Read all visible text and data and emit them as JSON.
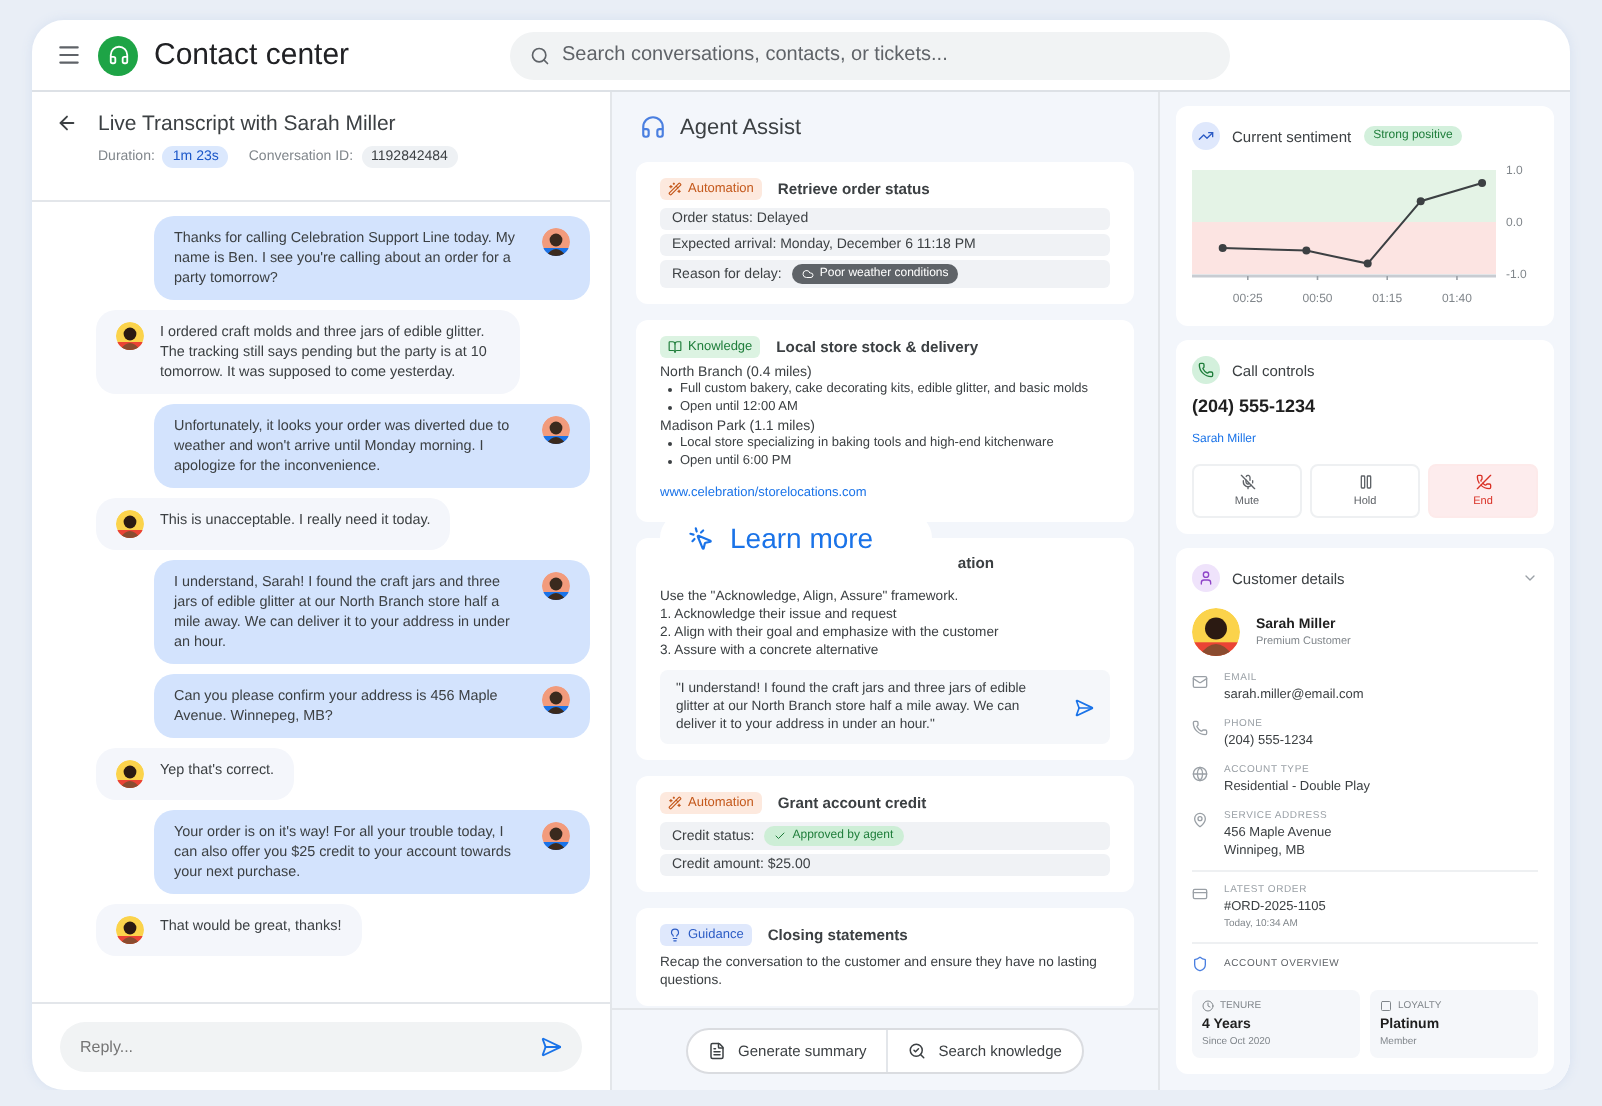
{
  "header": {
    "title": "Contact center",
    "search_placeholder": "Search conversations, contacts, or tickets..."
  },
  "transcript": {
    "title": "Live Transcript with Sarah Miller",
    "duration_label": "Duration:",
    "duration": "1m 23s",
    "conversation_label": "Conversation ID:",
    "conversation_id": "1192842484",
    "messages": [
      {
        "kind": "agent",
        "text": "Thanks for calling Celebration Support Line today. My name is Ben. I see you're calling about an order for a party tomorrow?"
      },
      {
        "kind": "customer",
        "text": "I ordered craft molds and three jars of edible glitter. The tracking still says pending but the party is at 10 tomorrow. It was supposed to come yesterday."
      },
      {
        "kind": "agent",
        "text": "Unfortunately, it looks your order was diverted due to weather and won't arrive until Monday morning. I apologize for the inconvenience."
      },
      {
        "kind": "customer",
        "text": "This is unacceptable. I really need it today."
      },
      {
        "kind": "agent",
        "text": "I understand, Sarah! I found the craft jars and three jars of edible glitter at our North Branch store half a mile away. We can deliver it to your address in under an hour."
      },
      {
        "kind": "agent",
        "text": "Can you please confirm your address is 456 Maple Avenue. Winnepeg, MB?"
      },
      {
        "kind": "customer",
        "text": "Yep that's correct."
      },
      {
        "kind": "agent",
        "text": "Your order is on it's way! For all your trouble today, I can also offer you $25 credit to your account towards your next purchase."
      },
      {
        "kind": "customer",
        "text": "That would be great, thanks!"
      }
    ],
    "reply_placeholder": "Reply..."
  },
  "assist": {
    "title": "Agent Assist",
    "cards": [
      {
        "kind": "automation",
        "badge": "Automation",
        "title": "Retrieve order status",
        "rows": [
          {
            "text": "Order status: Delayed"
          },
          {
            "text": "Expected arrival: Monday, December 6 11:18 PM"
          },
          {
            "text": "Reason for delay:",
            "chip": {
              "kind": "weather",
              "text": "Poor weather conditions"
            }
          }
        ]
      },
      {
        "kind": "knowledge",
        "badge": "Knowledge",
        "title": "Local store stock & delivery",
        "sections": [
          {
            "name": "North Branch (0.4 miles)",
            "bullets": [
              "Full custom bakery, cake decorating kits, edible glitter, and basic molds",
              "Open until 12:00 AM"
            ]
          },
          {
            "name": "Madison Park (1.1 miles)",
            "bullets": [
              "Local store specializing in baking tools and high-end kitchenware",
              "Open until 6:00 PM"
            ]
          }
        ],
        "link": "www.celebration/storelocations.com"
      },
      {
        "kind": "guidance_hidden",
        "title": "ation",
        "lines": [
          "Use the \"Acknowledge, Align, Assure\" framework.",
          "1. Acknowledge their issue and request",
          "2. Align with their goal and emphasize with the customer",
          "3. Assure with a concrete alternative"
        ],
        "suggestion": "\"I understand! I found the craft jars and three jars of edible glitter at our North Branch store half a mile away. We can deliver it to your address in under an hour.\""
      },
      {
        "kind": "automation",
        "badge": "Automation",
        "title": "Grant account credit",
        "rows": [
          {
            "text": "Credit status:",
            "chip": {
              "kind": "approved",
              "text": "Approved by agent"
            }
          },
          {
            "text": "Credit amount: $25.00"
          }
        ]
      },
      {
        "kind": "guidance",
        "badge": "Guidance",
        "title": "Closing statements",
        "lines": [
          "Recap the conversation to the customer and ensure they have no lasting questions."
        ]
      }
    ],
    "learn_more": "Learn more",
    "actions": [
      {
        "kind": "summary",
        "label": "Generate summary"
      },
      {
        "kind": "search",
        "label": "Search knowledge"
      }
    ]
  },
  "sentiment": {
    "title": "Current sentiment",
    "badge": "Strong positive",
    "chart_data": {
      "type": "line",
      "x": [
        16,
        46,
        68,
        87,
        109
      ],
      "series": [
        {
          "color": "#3c4043",
          "marker": "circle",
          "values": [
            -0.5,
            -0.55,
            -0.8,
            0.4,
            0.75
          ]
        }
      ],
      "xlim": [
        5,
        114
      ],
      "ylim": [
        -1,
        1
      ],
      "xticks": [
        {
          "value": 25,
          "label": "00:25"
        },
        {
          "value": 50,
          "label": "00:50"
        },
        {
          "value": 75,
          "label": "01:15"
        },
        {
          "value": 100,
          "label": "01:40"
        }
      ],
      "yticks": [
        {
          "value": 1,
          "label": "1.0"
        },
        {
          "value": 0,
          "label": "0.0"
        },
        {
          "value": -1,
          "label": "-1.0"
        }
      ]
    }
  },
  "call_controls": {
    "title": "Call controls",
    "phone": "(204) 555-1234",
    "name": "Sarah Miller",
    "buttons": [
      {
        "kind": "mute",
        "label": "Mute"
      },
      {
        "kind": "hold",
        "label": "Hold"
      },
      {
        "kind": "end",
        "label": "End"
      }
    ]
  },
  "customer": {
    "title": "Customer details",
    "expanded": true,
    "name": "Sarah Miller",
    "tier": "Premium Customer",
    "fields": [
      {
        "kind": "email",
        "label": "EMAIL",
        "value": "sarah.miller@email.com"
      },
      {
        "kind": "phone",
        "label": "PHONE",
        "value": "(204) 555-1234"
      },
      {
        "kind": "account",
        "label": "ACCOUNT TYPE",
        "value": "Residential - Double Play"
      },
      {
        "kind": "address",
        "label": "SERVICE ADDRESS",
        "lines": [
          "456 Maple Avenue",
          "Winnipeg, MB"
        ]
      },
      {
        "kind": "order",
        "label": "LATEST ORDER",
        "value": "#ORD-2025-1105",
        "sub": "Today, 10:34 AM"
      }
    ],
    "overview_title": "ACCOUNT OVERVIEW",
    "stats": [
      {
        "kind": "tenure",
        "label": "TENURE",
        "value": "4 Years",
        "sub": "Since Oct 2020"
      },
      {
        "kind": "loyalty",
        "label": "LOYALTY",
        "value": "Platinum",
        "sub": "Member"
      }
    ]
  }
}
